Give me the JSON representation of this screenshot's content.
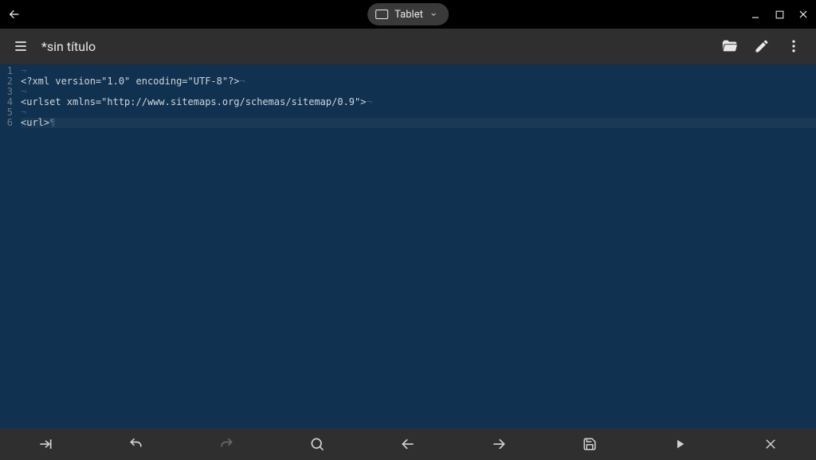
{
  "sysbar": {
    "device_label": "Tablet"
  },
  "appbar": {
    "title": "*sin título"
  },
  "editor": {
    "lines": [
      "",
      "<?xml version=\"1.0\" encoding=\"UTF-8\"?>",
      "",
      "<urlset xmlns=\"http://www.sitemaps.org/schemas/sitemap/0.9\">",
      "",
      "<url>"
    ],
    "caret_line_index": 5
  }
}
